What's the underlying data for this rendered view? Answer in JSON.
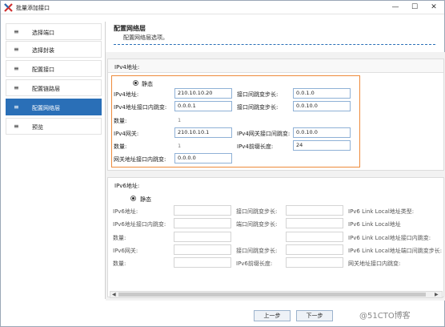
{
  "window": {
    "title": "批量添加接口",
    "min_glyph": "—",
    "max_glyph": "☐",
    "close_glyph": "✕"
  },
  "sidebar": {
    "items": [
      {
        "icon": "≡",
        "label": "选择端口",
        "active": false
      },
      {
        "icon": "≡",
        "label": "选择封装",
        "active": false
      },
      {
        "icon": "≡",
        "label": "配置接口",
        "active": false
      },
      {
        "icon": "≡",
        "label": "配置链路层",
        "active": false
      },
      {
        "icon": "≡",
        "label": "配置网络层",
        "active": true
      },
      {
        "icon": "≡",
        "label": "预览",
        "active": false
      }
    ]
  },
  "page": {
    "title": "配置网络层",
    "subtitle": "配置网络层选项。"
  },
  "ipv4": {
    "header": "IPv4地址:",
    "mode_label": "静态",
    "addr_label": "IPv4地址:",
    "addr_value": "210.10.10.20",
    "port_step_label": "接口间跳变步长:",
    "port_step_value": "0.0.1.0",
    "inner_step_label": "IPv4地址接口内跳变:",
    "inner_step_value": "0.0.0.1",
    "port_inner_label": "接口间跳变步长:",
    "port_inner_value": "0.0.10.0",
    "count_label": "数量:",
    "count_value": "1",
    "gw_label": "IPv4网关:",
    "gw_value": "210.10.10.1",
    "gw_inner_label": "IPv4网关接口间跳变:",
    "gw_inner_value": "0.0.10.0",
    "count2_label": "数量:",
    "count2_value": "1",
    "prefix_label": "IPv4前缀长度:",
    "prefix_value": "24",
    "gw_port_inner_label": "网关地址接口内跳变:",
    "gw_port_inner_value": "0.0.0.0"
  },
  "ipv6": {
    "header": "IPv6地址:",
    "mode_label": "静态",
    "addr_label": "IPv6地址:",
    "port_step_label": "接口间跳变步长:",
    "ll_type_label": "IPv6 Link Local地址类型:",
    "inner_step_label": "IPv6地址接口内跳变:",
    "port_inner_label": "端口间跳变步长:",
    "ll_addr_label": "IPv6 Link Local地址",
    "count_label": "数量:",
    "ll_inner_label": "IPv6 Link Local地址接口内跳变:",
    "gw_label": "IPv6网关:",
    "gw_step_label": "接口间跳变步长:",
    "ll_port_step_label": "IPv6 Link Local地址端口间跳变步长:",
    "count2_label": "数量:",
    "prefix_label": "IPv6前缀长度:",
    "gw_inner_label": "网关地址接口内跳变:"
  },
  "footer": {
    "prev_label": "上一步",
    "next_label": "下一步",
    "watermark": "@51CTO博客"
  }
}
